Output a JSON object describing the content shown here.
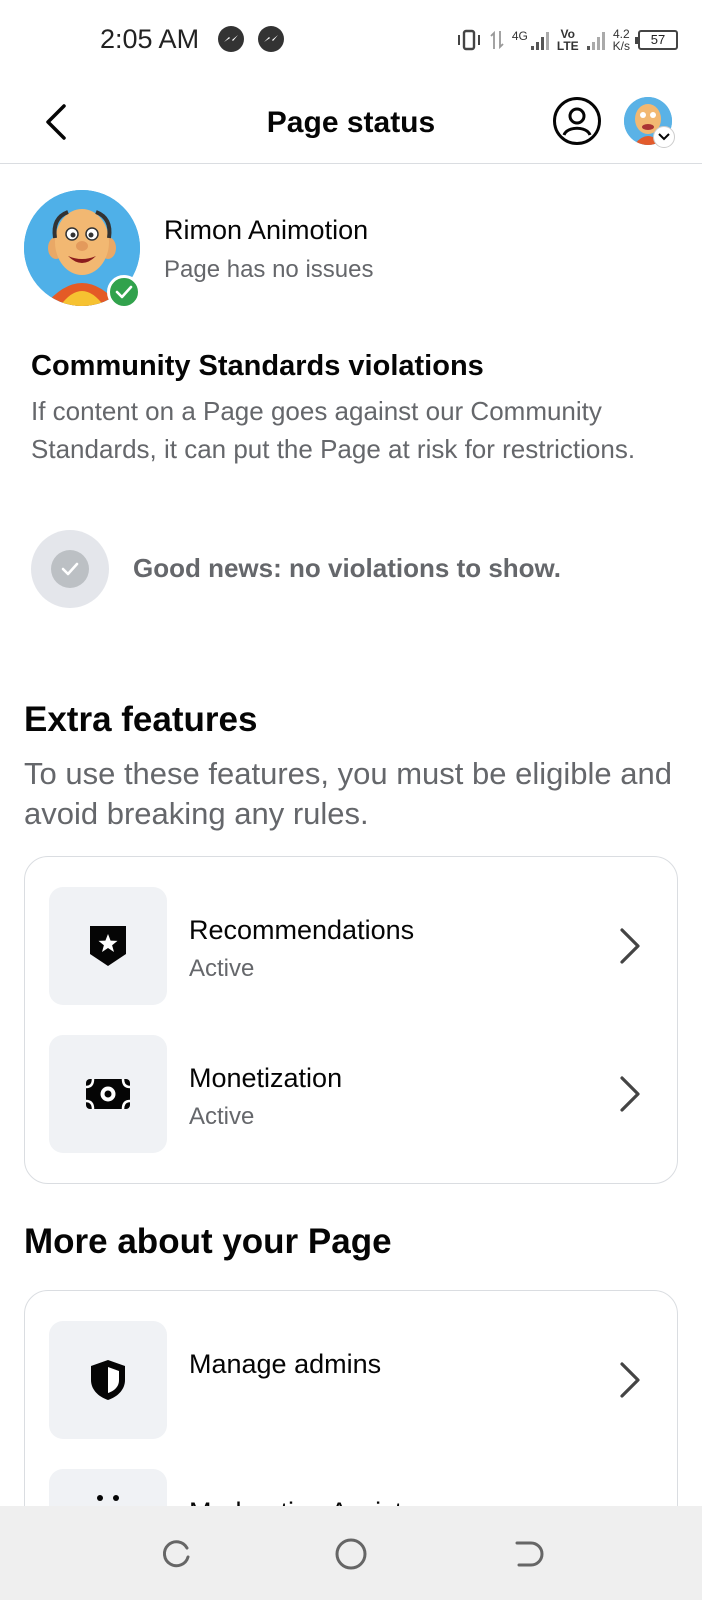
{
  "status_bar": {
    "time": "2:05 AM",
    "network_4g": "4G",
    "volte_top": "Vo",
    "volte_bottom": "LTE",
    "speed_value": "4.2",
    "speed_unit": "K/s",
    "battery": "57"
  },
  "header": {
    "title": "Page status"
  },
  "page": {
    "name": "Rimon Animotion",
    "status": "Page has no issues"
  },
  "community": {
    "title": "Community Standards violations",
    "description": "If content on a Page goes against our Community Standards, it can put the Page at risk for restrictions.",
    "good_news": "Good news: no violations to show."
  },
  "extra_features": {
    "title": "Extra features",
    "description": "To use these features, you must be eligible and avoid breaking any rules.",
    "items": [
      {
        "title": "Recommendations",
        "status": "Active",
        "icon": "shield-star-icon"
      },
      {
        "title": "Monetization",
        "status": "Active",
        "icon": "money-icon"
      }
    ]
  },
  "more_about": {
    "title": "More about your Page",
    "items": [
      {
        "title": "Manage admins",
        "icon": "shield-icon"
      },
      {
        "title": "Moderation Assist",
        "icon": "moderation-icon"
      }
    ]
  },
  "colors": {
    "success_green": "#31a24c",
    "secondary_text": "#65676b",
    "surface_gray": "#f0f2f5"
  }
}
